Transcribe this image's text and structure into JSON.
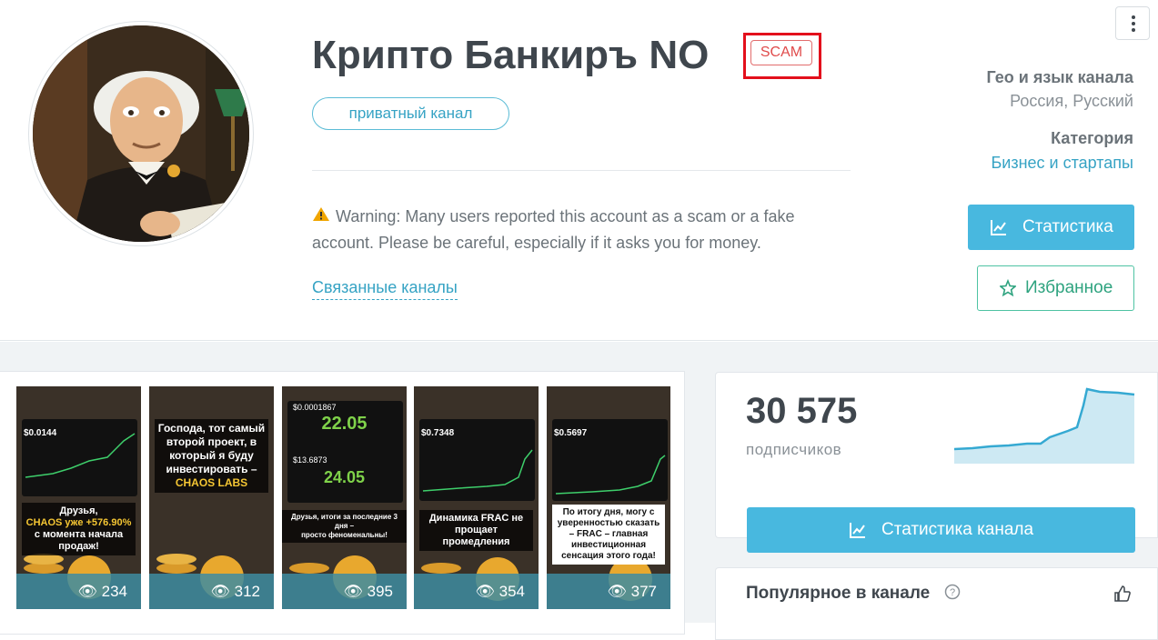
{
  "channel": {
    "title": "Крипто Банкиръ NO",
    "scam_badge": "SCAM",
    "private_label": "приватный канал",
    "warning_text": "Warning: Many users reported this account as a scam or a fake account. Please be careful, especially if it asks you for money.",
    "related_link": "Связанные каналы"
  },
  "meta": {
    "geo_label": "Гео и язык канала",
    "geo_value": "Россия, Русский",
    "category_label": "Категория",
    "category_value": "Бизнес и стартапы"
  },
  "actions": {
    "stats_label": "Статистика",
    "favorite_label": "Избранное"
  },
  "posts": [
    {
      "views": "234",
      "caption_lines": [
        "Друзья,",
        "CHAOS уже +576.90%",
        "с момента начала",
        "продаж!"
      ],
      "ticker": "$0.0144"
    },
    {
      "views": "312",
      "caption_lines": [
        "Господа, тот самый",
        "второй проект, в",
        "который я буду",
        "инвестировать –",
        "CHAOS LABS"
      ],
      "ticker": ""
    },
    {
      "views": "395",
      "caption_lines": [
        "Друзья, итоги за последние 3 дня –",
        "просто феноменальны!"
      ],
      "ticker": "$0.0001867",
      "big1": "22.05",
      "ticker2": "$13.6873",
      "big2": "24.05"
    },
    {
      "views": "354",
      "caption_lines": [
        "Динамика FRAC не",
        "прощает промедления"
      ],
      "ticker": "$0.7348"
    },
    {
      "views": "377",
      "caption_lines": [
        "По итогу дня, могу с",
        "уверенностью сказать",
        "– FRAC – главная",
        "инвестиционная",
        "сенсация этого года!"
      ],
      "ticker": "$0.5697"
    }
  ],
  "subscribers": {
    "count": "30 575",
    "label": "подписчиков",
    "channel_stats_label": "Статистика канала"
  },
  "popular": {
    "title": "Популярное в канале"
  },
  "colors": {
    "accent": "#48b8df",
    "scam": "#e3101c",
    "favorite": "#2ea37f"
  },
  "icons": [
    "more-vert-icon",
    "warning-icon",
    "chart-icon",
    "star-icon",
    "help-icon",
    "thumbs-up-icon",
    "eye-icon"
  ]
}
